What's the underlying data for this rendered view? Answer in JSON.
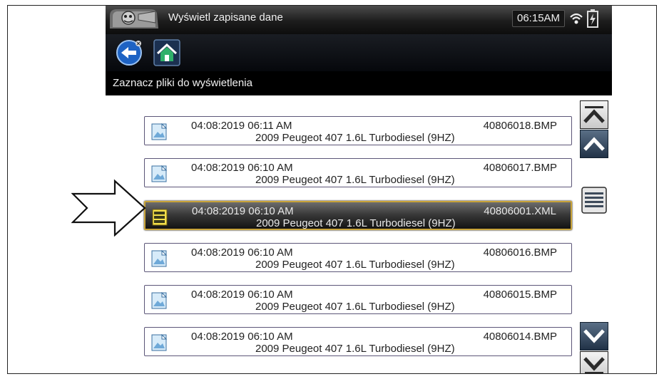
{
  "header": {
    "title": "Wyświetl zapisane dane",
    "time": "06:15AM",
    "logo_icon": "snap-on-mascot-icon",
    "wifi_icon": "wifi-icon",
    "battery_icon": "battery-charging-icon"
  },
  "toolbar": {
    "back_icon": "back-arrow-icon",
    "home_icon": "home-icon"
  },
  "subheader": {
    "label": "Zaznacz pliki do wyświetlenia"
  },
  "files": [
    {
      "date": "04:08:2019 06:11 AM",
      "filename": "40806018.BMP",
      "vehicle": "2009 Peugeot 407 1.6L Turbodiesel (9HZ)",
      "icon": "image-file-icon",
      "selected": false
    },
    {
      "date": "04:08:2019 06:10 AM",
      "filename": "40806017.BMP",
      "vehicle": "2009 Peugeot 407 1.6L Turbodiesel (9HZ)",
      "icon": "image-file-icon",
      "selected": false
    },
    {
      "date": "04:08:2019 06:10 AM",
      "filename": "40806001.XML",
      "vehicle": "2009 Peugeot 407 1.6L Turbodiesel (9HZ)",
      "icon": "data-file-icon",
      "selected": true
    },
    {
      "date": "04:08:2019 06:10 AM",
      "filename": "40806016.BMP",
      "vehicle": "2009 Peugeot 407 1.6L Turbodiesel (9HZ)",
      "icon": "image-file-icon",
      "selected": false
    },
    {
      "date": "04:08:2019 06:10 AM",
      "filename": "40806015.BMP",
      "vehicle": "2009 Peugeot 407 1.6L Turbodiesel (9HZ)",
      "icon": "image-file-icon",
      "selected": false
    },
    {
      "date": "04:08:2019 06:10 AM",
      "filename": "40806014.BMP",
      "vehicle": "2009 Peugeot 407 1.6L Turbodiesel (9HZ)",
      "icon": "image-file-icon",
      "selected": false
    }
  ],
  "scroll": {
    "top_icon": "scroll-to-top-icon",
    "up_icon": "scroll-up-icon",
    "thumb_icon": "scroll-thumb-icon",
    "down_icon": "scroll-down-icon",
    "bottom_icon": "scroll-to-bottom-icon"
  },
  "annotation": {
    "pointer_icon": "callout-arrow-icon"
  },
  "colors": {
    "header_bg": "#000000",
    "selection_border": "#c9a43a",
    "row_border": "#5c5678",
    "scroll_button_dark": "#213247"
  }
}
